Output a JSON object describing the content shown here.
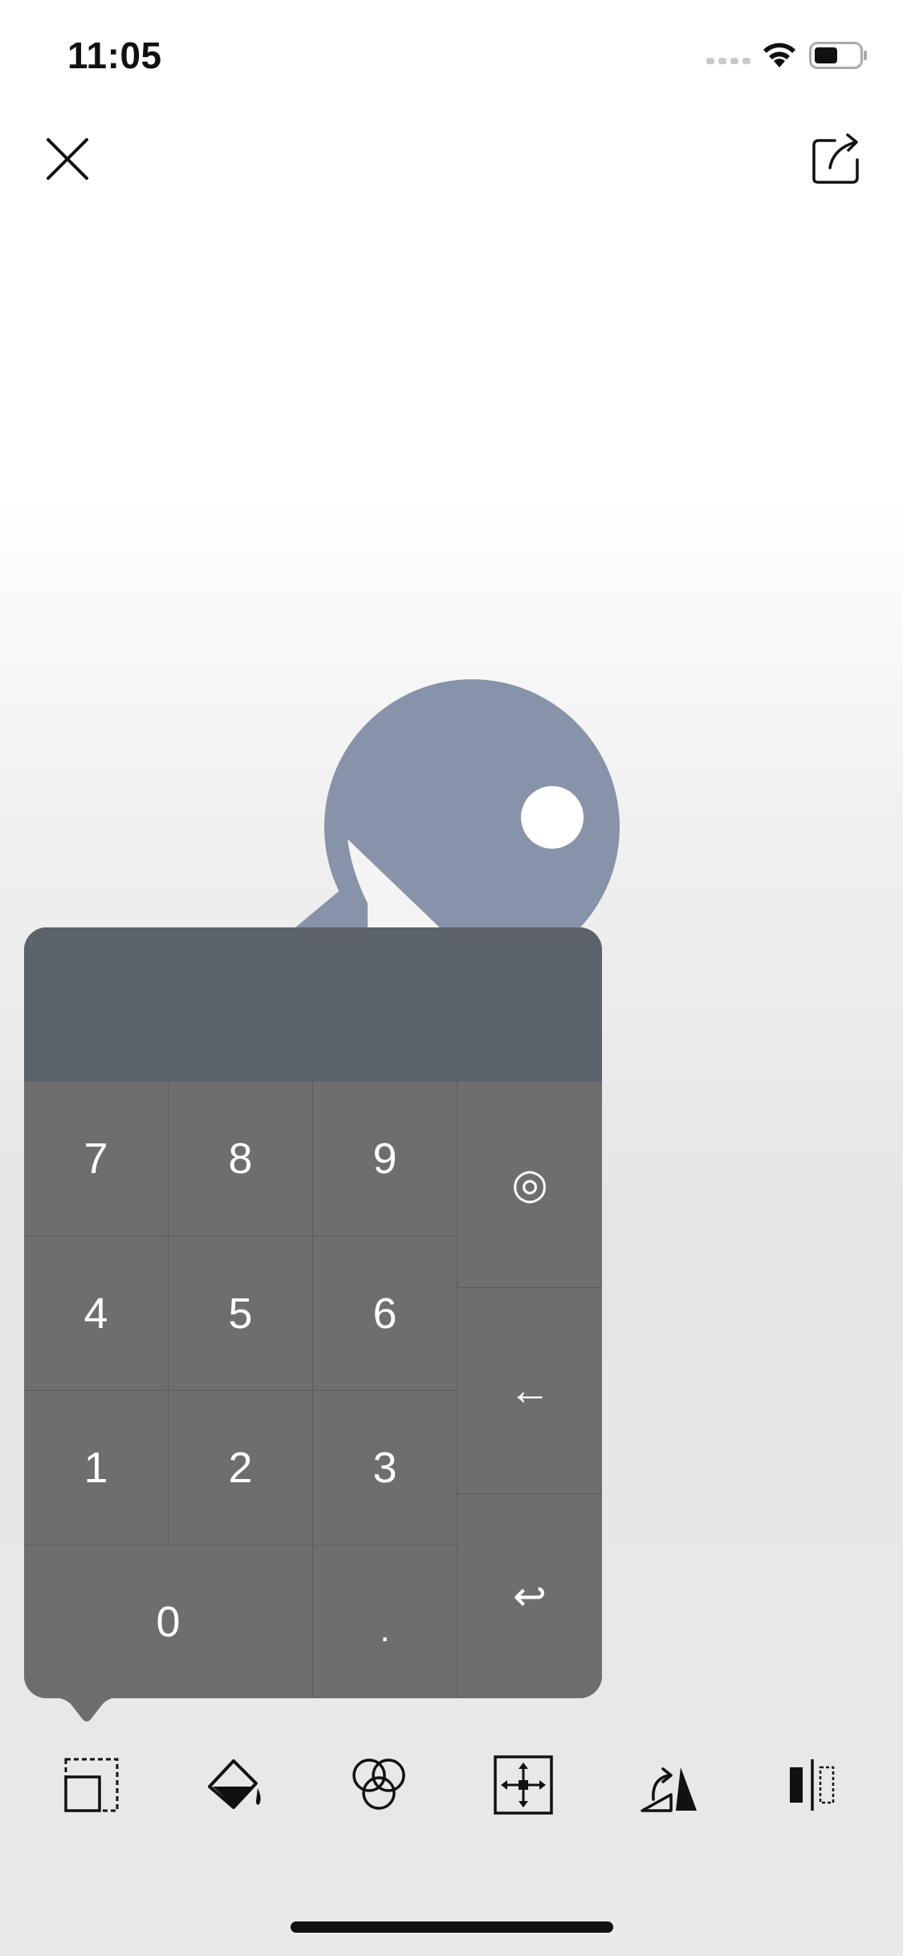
{
  "status_bar": {
    "time": "11:05",
    "icons": [
      "signal-icon",
      "wifi-icon",
      "battery-icon"
    ]
  },
  "nav": {
    "close_icon": "close-icon",
    "share_icon": "share-icon"
  },
  "canvas": {
    "shape_color": "#8793a8"
  },
  "keypad": {
    "display_value": "",
    "keys": {
      "k7": "7",
      "k8": "8",
      "k9": "9",
      "k4": "4",
      "k5": "5",
      "k6": "6",
      "k1": "1",
      "k2": "2",
      "k3": "3",
      "k0": "0",
      "dot": ".",
      "target": "◎",
      "backspace": "←",
      "enter": "↩"
    },
    "colors": {
      "display": "#5c626a",
      "key": "#6e6e6e"
    }
  },
  "toolbar": {
    "tools": [
      "resize-icon",
      "fill-icon",
      "blend-icon",
      "move-icon",
      "transform-icon",
      "mirror-icon"
    ]
  }
}
